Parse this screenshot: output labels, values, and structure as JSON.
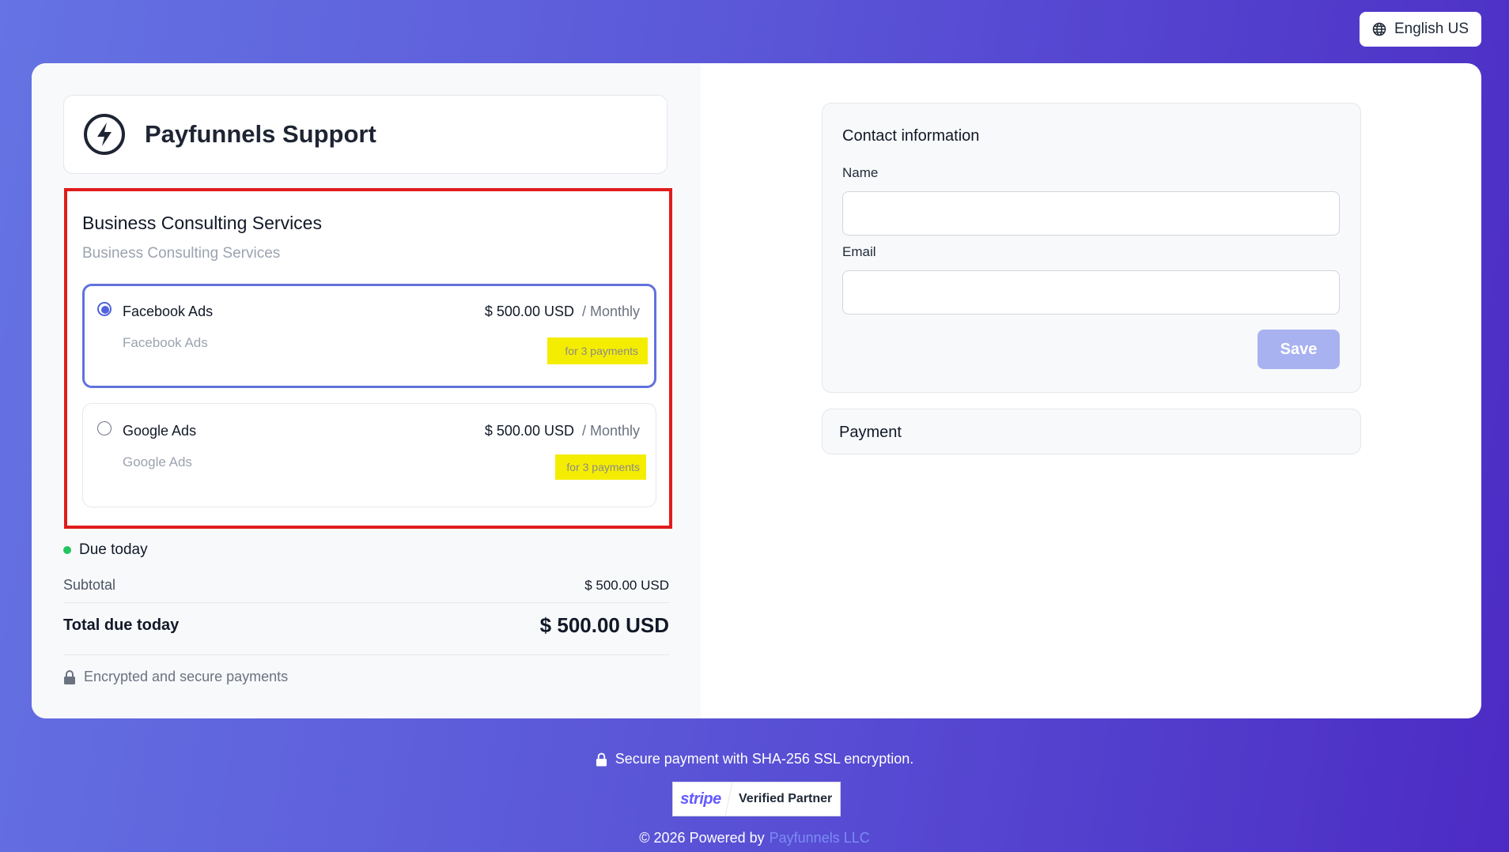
{
  "header": {
    "language_label": "English US",
    "language_icon": "globe-icon"
  },
  "brand": {
    "title": "Payfunnels Support",
    "icon": "lightning-bolt-icon"
  },
  "product": {
    "title": "Business Consulting Services",
    "subtitle": "Business Consulting Services",
    "options": [
      {
        "name": "Facebook Ads",
        "description": "Facebook Ads",
        "price": "$ 500.00 USD",
        "period": "/ Monthly",
        "installments": "for 3 payments",
        "selected": true
      },
      {
        "name": "Google Ads",
        "description": "Google Ads",
        "price": "$ 500.00 USD",
        "period": "/ Monthly",
        "installments": "for 3 payments",
        "selected": false
      }
    ]
  },
  "summary": {
    "due_label": "Due today",
    "subtotal_label": "Subtotal",
    "subtotal_value": "$ 500.00 USD",
    "total_label": "Total due today",
    "total_value": "$ 500.00 USD",
    "secure_text": "Encrypted and secure payments"
  },
  "contact": {
    "title": "Contact information",
    "name_label": "Name",
    "name_value": "",
    "email_label": "Email",
    "email_value": "",
    "save_label": "Save"
  },
  "payment": {
    "title": "Payment"
  },
  "footer": {
    "secure_text": "Secure payment with SHA-256 SSL encryption.",
    "stripe_logo": "stripe",
    "stripe_badge_label": "Verified Partner",
    "copyright_prefix": "© 2026 Powered by",
    "company": "Payfunnels LLC"
  },
  "colors": {
    "accent": "#4f63dd",
    "highlight_border": "#e01b1b",
    "badge_bg": "#f5ed00",
    "due_dot": "#22c55e",
    "save_button": "#a8b2f0"
  }
}
